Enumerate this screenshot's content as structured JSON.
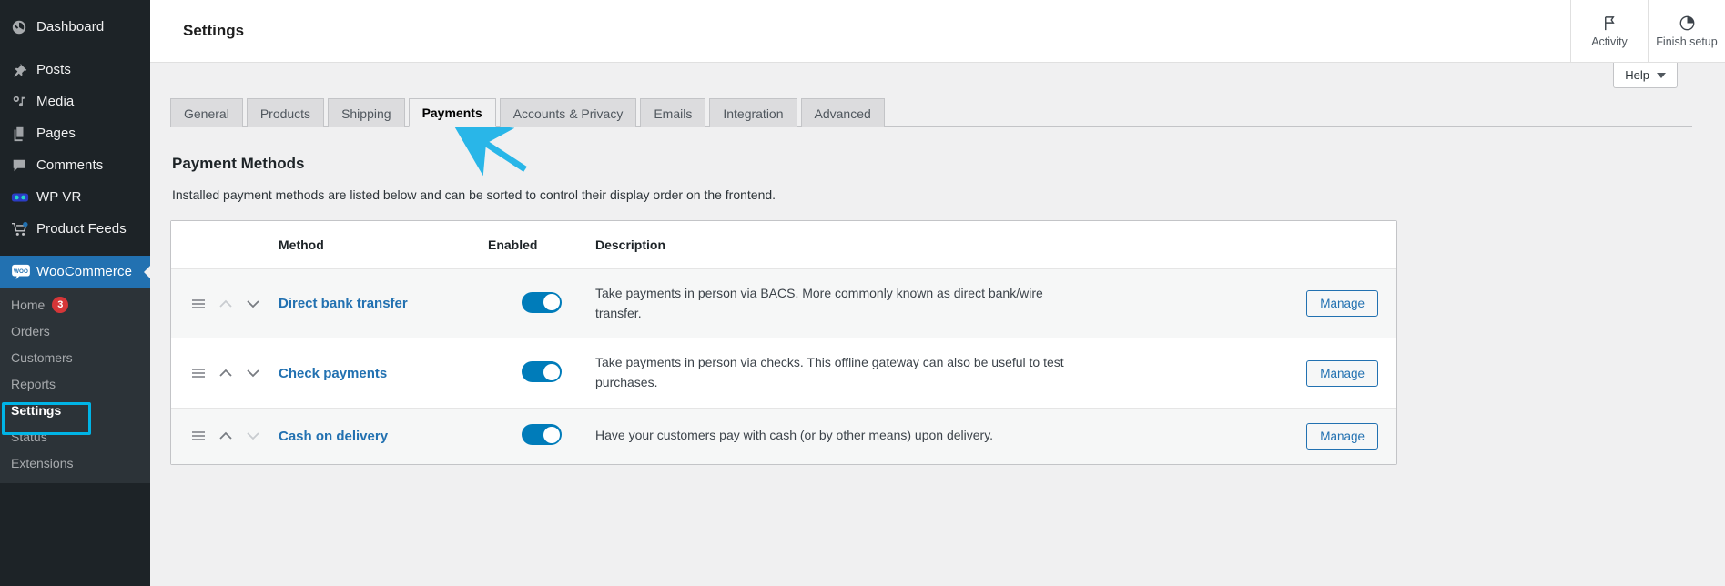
{
  "sidebar": {
    "items": [
      {
        "label": "Dashboard",
        "icon": "dashboard-icon"
      },
      {
        "label": "Posts",
        "icon": "pin-icon"
      },
      {
        "label": "Media",
        "icon": "media-icon"
      },
      {
        "label": "Pages",
        "icon": "pages-icon"
      },
      {
        "label": "Comments",
        "icon": "comment-icon"
      },
      {
        "label": "WP VR",
        "icon": "vr-headset-icon"
      },
      {
        "label": "Product Feeds",
        "icon": "cart-icon"
      }
    ],
    "active": {
      "label": "WooCommerce",
      "icon": "woo-icon"
    },
    "submenu": [
      {
        "label": "Home",
        "badge": "3"
      },
      {
        "label": "Orders",
        "badge": ""
      },
      {
        "label": "Customers",
        "badge": ""
      },
      {
        "label": "Reports",
        "badge": ""
      },
      {
        "label": "Settings",
        "badge": ""
      },
      {
        "label": "Status",
        "badge": ""
      },
      {
        "label": "Extensions",
        "badge": ""
      }
    ],
    "highlight_color": "#00b4e6"
  },
  "topbar": {
    "title": "Settings",
    "activity_label": "Activity",
    "finish_setup_label": "Finish setup",
    "help_label": "Help"
  },
  "tabs": [
    {
      "label": "General",
      "active": false
    },
    {
      "label": "Products",
      "active": false
    },
    {
      "label": "Shipping",
      "active": false
    },
    {
      "label": "Payments",
      "active": true
    },
    {
      "label": "Accounts & Privacy",
      "active": false
    },
    {
      "label": "Emails",
      "active": false
    },
    {
      "label": "Integration",
      "active": false
    },
    {
      "label": "Advanced",
      "active": false
    }
  ],
  "page": {
    "heading": "Payment Methods",
    "description": "Installed payment methods are listed below and can be sorted to control their display order on the frontend."
  },
  "table": {
    "headers": {
      "sort": "",
      "method": "Method",
      "enabled": "Enabled",
      "description": "Description",
      "action": ""
    },
    "rows": [
      {
        "method": "Direct bank transfer",
        "enabled": true,
        "description": "Take payments in person via BACS. More commonly known as direct bank/wire transfer.",
        "action_label": "Manage",
        "up_enabled": false,
        "down_enabled": true
      },
      {
        "method": "Check payments",
        "enabled": true,
        "description": "Take payments in person via checks. This offline gateway can also be useful to test purchases.",
        "action_label": "Manage",
        "up_enabled": true,
        "down_enabled": true
      },
      {
        "method": "Cash on delivery",
        "enabled": true,
        "description": "Have your customers pay with cash (or by other means) upon delivery.",
        "action_label": "Manage",
        "up_enabled": true,
        "down_enabled": false
      }
    ]
  },
  "annotation": {
    "arrow_color": "#29b6e8",
    "points_at": "Payments"
  },
  "colors": {
    "accent": "#2271b1",
    "toggle_on": "#007cba",
    "badge": "#d63638",
    "sidebar_bg": "#1d2327"
  }
}
